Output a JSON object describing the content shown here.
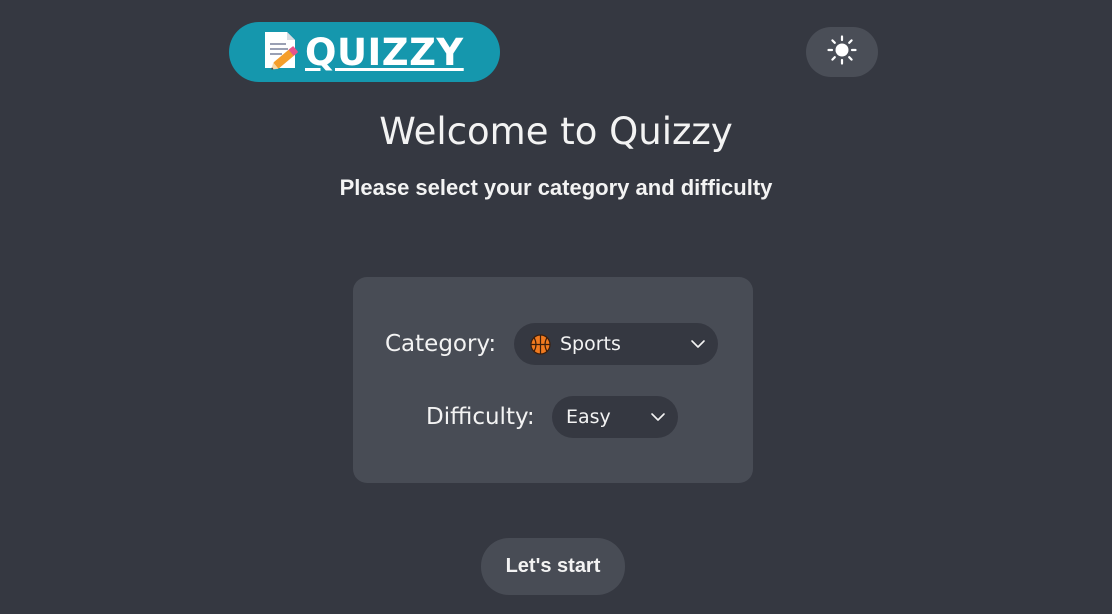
{
  "header": {
    "logo_text": "QUIZZY",
    "logo_icon": "memo-pencil-icon",
    "theme_toggle_icon": "sun-icon"
  },
  "main": {
    "title": "Welcome to Quizzy",
    "subtitle": "Please select your category and difficulty"
  },
  "form": {
    "category_label": "Category:",
    "category_value": "Sports",
    "category_icon": "basketball-icon",
    "difficulty_label": "Difficulty:",
    "difficulty_value": "Easy"
  },
  "actions": {
    "start_label": "Let's start"
  },
  "colors": {
    "background": "#353841",
    "card": "#484c55",
    "accent": "#1597ad",
    "text": "#f3f3f3"
  }
}
